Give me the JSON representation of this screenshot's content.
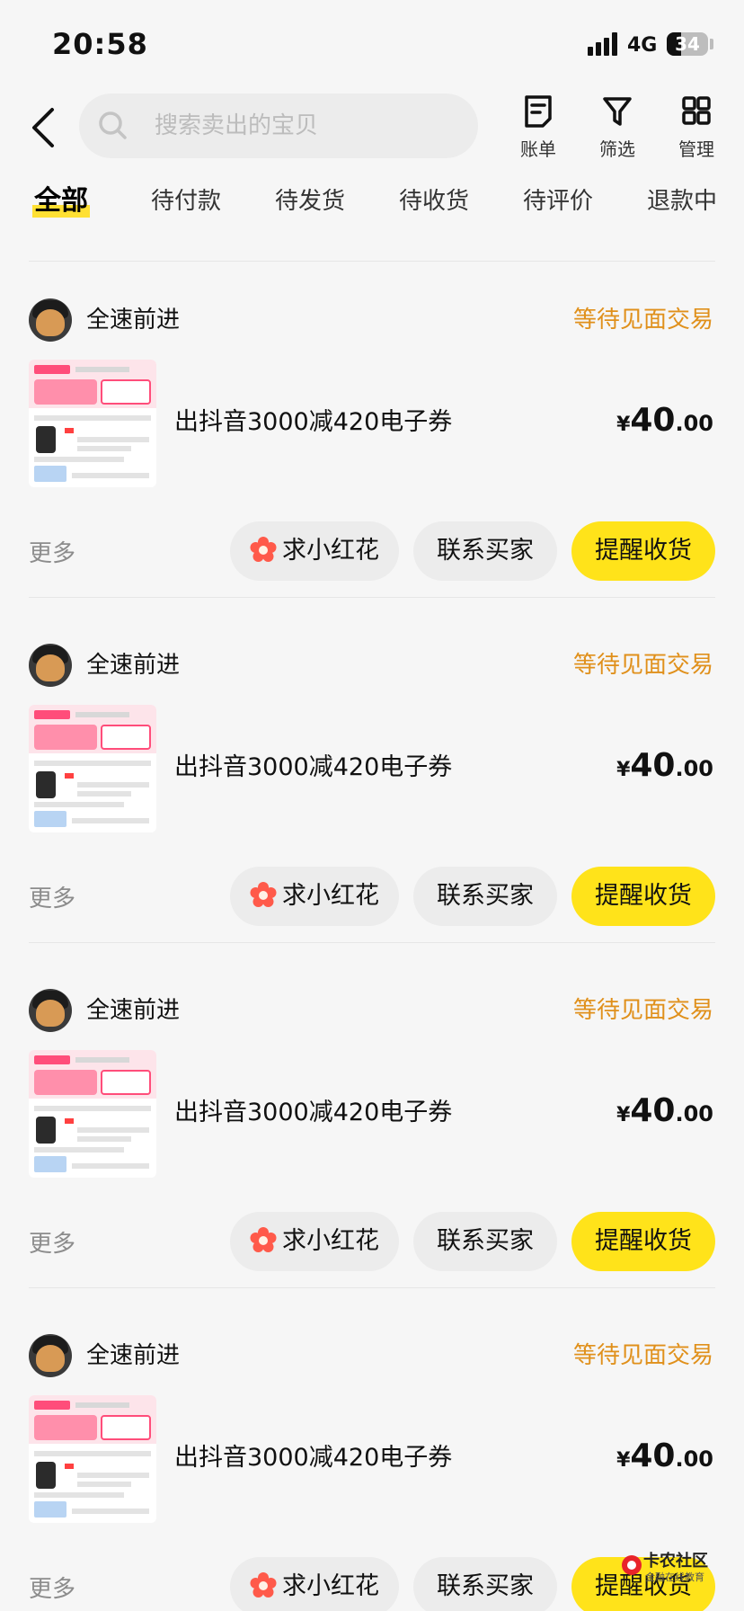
{
  "status_bar": {
    "time": "20:58",
    "network": "4G",
    "battery": "34",
    "battery_level": 0.34
  },
  "header": {
    "search_placeholder": "搜索卖出的宝贝",
    "actions": [
      {
        "icon": "bill-icon",
        "label": "账单"
      },
      {
        "icon": "filter-icon",
        "label": "筛选"
      },
      {
        "icon": "grid-icon",
        "label": "管理"
      }
    ]
  },
  "tabs": [
    "全部",
    "待付款",
    "待发货",
    "待收货",
    "待评价",
    "退款中"
  ],
  "active_tab": "全部",
  "orders": [
    {
      "seller": "全速前进",
      "status": "等待见面交易",
      "title": "出抖音3000减420电子券",
      "currency": "¥",
      "price_int": "40",
      "price_dec": ".00",
      "more": "更多",
      "btn_flower": "求小红花",
      "btn_contact": "联系买家",
      "btn_remind": "提醒收货"
    },
    {
      "seller": "全速前进",
      "status": "等待见面交易",
      "title": "出抖音3000减420电子券",
      "currency": "¥",
      "price_int": "40",
      "price_dec": ".00",
      "more": "更多",
      "btn_flower": "求小红花",
      "btn_contact": "联系买家",
      "btn_remind": "提醒收货"
    },
    {
      "seller": "全速前进",
      "status": "等待见面交易",
      "title": "出抖音3000减420电子券",
      "currency": "¥",
      "price_int": "40",
      "price_dec": ".00",
      "more": "更多",
      "btn_flower": "求小红花",
      "btn_contact": "联系买家",
      "btn_remind": "提醒收货"
    },
    {
      "seller": "全速前进",
      "status": "等待见面交易",
      "title": "出抖音3000减420电子券",
      "currency": "¥",
      "price_int": "40",
      "price_dec": ".00",
      "more": "更多",
      "btn_flower": "求小红花",
      "btn_contact": "联系买家",
      "btn_remind": "提醒收货"
    }
  ],
  "watermark": {
    "title": "卡农社区",
    "subtitle": "金融在线教育"
  },
  "colors": {
    "accent_yellow": "#ffe31a",
    "status_orange": "#e0901b",
    "flower_red": "#ff5a4a"
  }
}
